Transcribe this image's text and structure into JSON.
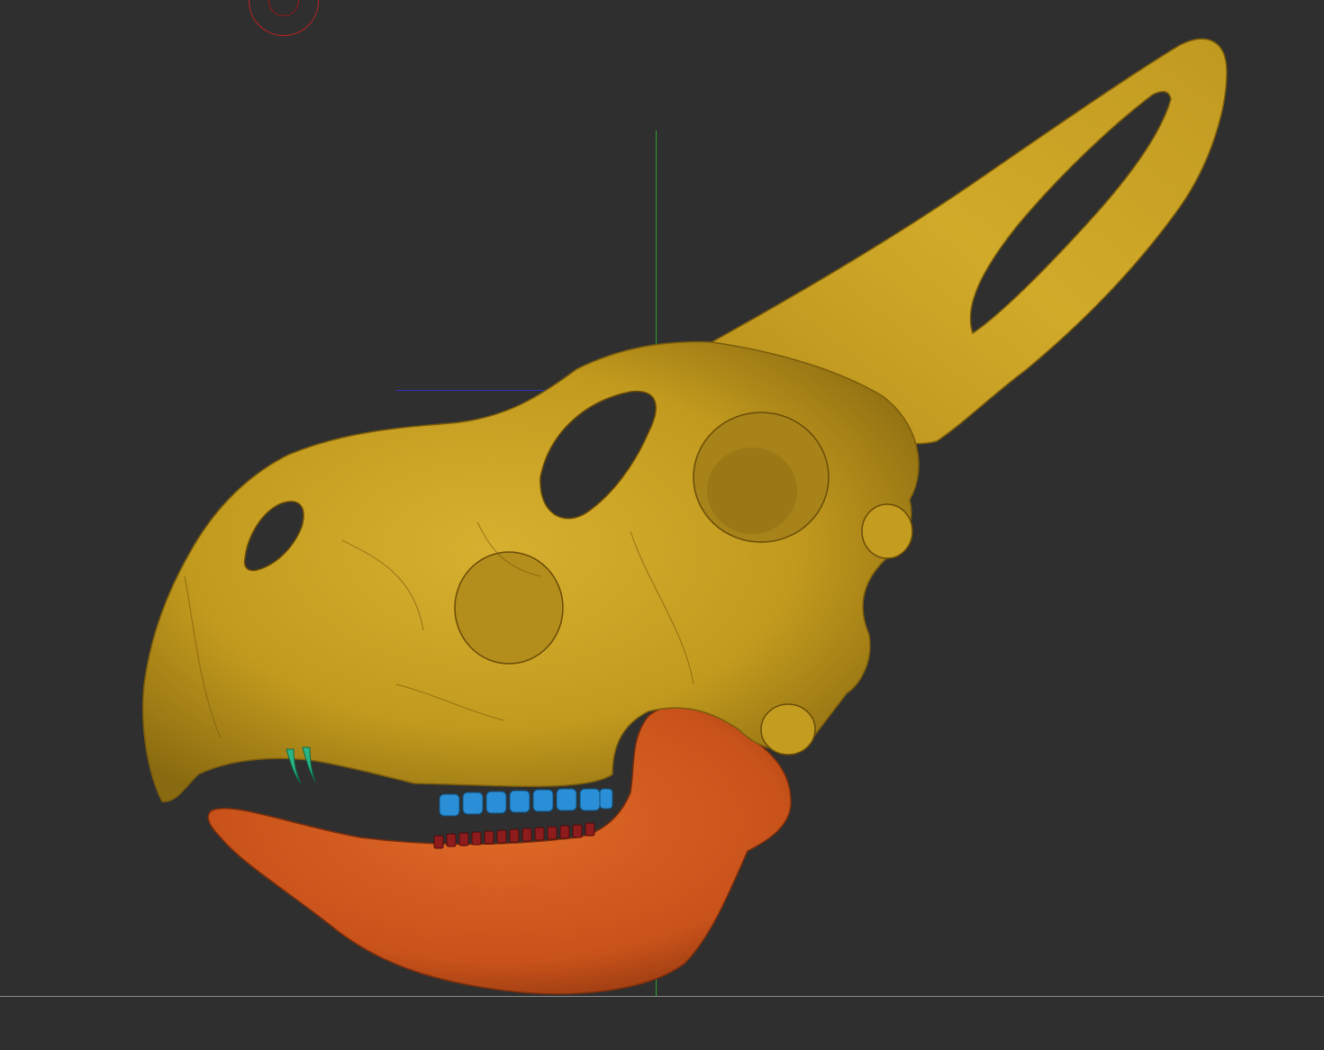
{
  "viewport": {
    "background_color": "#2f2f2f",
    "floor_line_color": "#8a8a8a",
    "y_axis_color": "#2fa02f",
    "x_axis_color": "#3030c8",
    "gizmo_color": "#c42020"
  },
  "model": {
    "subtools": [
      {
        "name": "skull",
        "color": "#c9a020"
      },
      {
        "name": "mandible",
        "color": "#d0581c"
      },
      {
        "name": "upper-teeth",
        "color": "#2a8fd6"
      },
      {
        "name": "lower-teeth",
        "color": "#8e1c1c"
      },
      {
        "name": "predentary-teeth",
        "color": "#2bb585"
      }
    ]
  }
}
